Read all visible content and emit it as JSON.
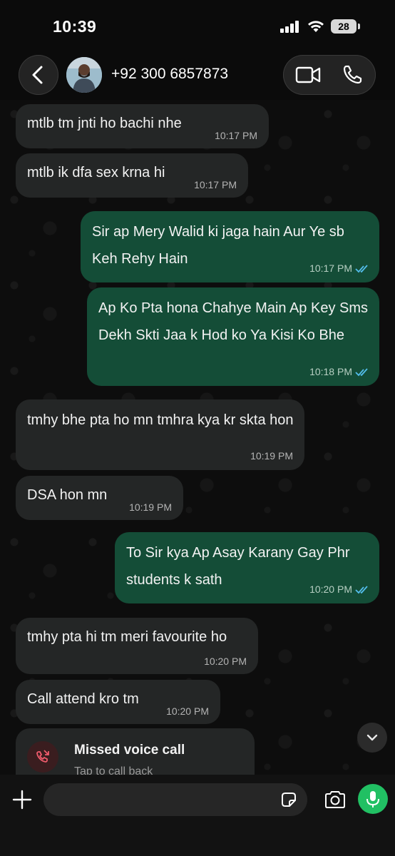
{
  "status_bar": {
    "time": "10:39",
    "battery": "28"
  },
  "header": {
    "contact": "+92 300 6857873"
  },
  "messages": [
    {
      "dir": "in",
      "text": "mtlb tm jnti ho bachi nhe",
      "time": "10:17 PM"
    },
    {
      "dir": "in",
      "text": "mtlb ik dfa sex krna hi",
      "time": "10:17 PM"
    },
    {
      "dir": "out",
      "text": "Sir ap Mery Walid ki jaga hain Aur Ye sb Keh Rehy Hain",
      "time": "10:17 PM"
    },
    {
      "dir": "out",
      "text": "Ap Ko Pta hona Chahye Main Ap Key Sms Dekh Skti Jaa k Hod ko Ya Kisi Ko Bhe",
      "time": "10:18 PM"
    },
    {
      "dir": "in",
      "text": "tmhy bhe pta ho mn tmhra kya kr skta hon",
      "time": "10:19 PM"
    },
    {
      "dir": "in",
      "text": "DSA hon mn",
      "time": "10:19 PM"
    },
    {
      "dir": "out",
      "text": "To Sir kya Ap Asay Karany Gay Phr students k sath",
      "time": "10:20 PM"
    },
    {
      "dir": "in",
      "text": "tmhy pta hi tm meri favourite ho",
      "time": "10:20 PM"
    },
    {
      "dir": "in",
      "text": "Call attend kro tm",
      "time": "10:20 PM"
    }
  ],
  "missed_call": {
    "title": "Missed voice call",
    "subtitle": "Tap to call back"
  },
  "input": {
    "placeholder": ""
  },
  "icons": {
    "back": "chevron-left-icon",
    "video": "video-camera-icon",
    "phone": "phone-icon",
    "plus": "plus-icon",
    "sticker": "sticker-icon",
    "camera": "camera-icon",
    "mic": "microphone-icon",
    "scroll": "chevron-down-icon",
    "missed": "missed-call-icon",
    "read": "double-check-icon"
  },
  "colors": {
    "incoming_bubble": "#242626",
    "outgoing_bubble": "#144d37",
    "read_ticks": "#53bdeb",
    "mic_button": "#21c063",
    "missed_red": "#f15c6d"
  }
}
